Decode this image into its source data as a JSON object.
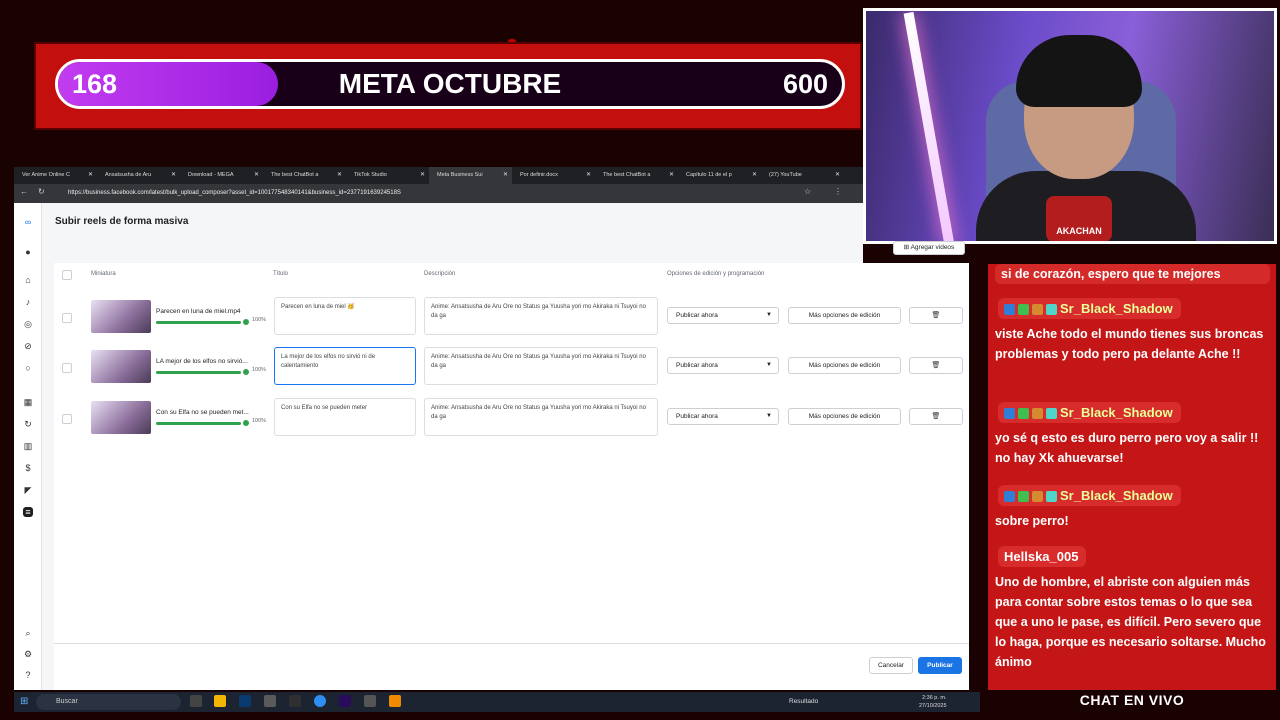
{
  "goal": {
    "current": "168",
    "title": "META OCTUBRE",
    "max": "600",
    "progress_fraction": 0.28
  },
  "webcam": {
    "logo_text": "AKACHAN"
  },
  "browser": {
    "tabs": [
      {
        "label": "Ver Anime Online C"
      },
      {
        "label": "Ansatsusha de Aru"
      },
      {
        "label": "Download - MEGA"
      },
      {
        "label": "The best ChatBot a"
      },
      {
        "label": "TikTok Studio"
      },
      {
        "label": "Meta Business Sui"
      },
      {
        "label": "Por definir.docx"
      },
      {
        "label": "The best ChatBot a"
      },
      {
        "label": "Capítulo 11 de el p"
      },
      {
        "label": "(27) YouTube"
      }
    ],
    "url": "https://business.facebook.com/latest/bulk_upload_composer?asset_id=100177548340141&business_id=237719163924518S"
  },
  "app": {
    "title": "Subir reels de forma masiva",
    "add_videos": "Agregar videos",
    "columns": {
      "thumb": "Miniatura",
      "title": "Título",
      "desc": "Descripción",
      "options": "Opciones de edición y programación"
    },
    "rows": [
      {
        "filename": "Parecen en luna de miel.mp4",
        "percent": "100%",
        "title": "Parecen en luna de miel 🥳",
        "description": "Anime: Ansatsusha de Aru Ore no Status ga Yuusha yori mo Akiraka ni Tsuyoi no da ga",
        "schedule": "Publicar ahora",
        "more": "Más opciones de edición"
      },
      {
        "filename": "LA mejor de los elfos no sirvió...",
        "percent": "100%",
        "title": "La mejor de los elfos no sirvió ni de calentamiento",
        "description": "Anime: Ansatsusha de Aru Ore no Status ga Yuusha yori mo Akiraka ni Tsuyoi no da ga",
        "schedule": "Publicar ahora",
        "more": "Más opciones de edición"
      },
      {
        "filename": "Con su Elfa no se pueden met...",
        "percent": "100%",
        "title": "Con su Elfa no se pueden meter",
        "description": "Anime: Ansatsusha de Aru Ore no Status ga Yuusha yori mo Akiraka ni Tsuyoi no da ga",
        "schedule": "Publicar ahora",
        "more": "Más opciones de edición"
      }
    ],
    "cancel": "Cancelar",
    "publish": "Publicar"
  },
  "taskbar": {
    "search": "Buscar",
    "tray": "Resultado",
    "time": "2:36 p. m.",
    "date": "27/10/2025"
  },
  "chat": {
    "messages": [
      {
        "user": "",
        "text": "si de corazón, espero que te mejores"
      },
      {
        "user": "Sr_Black_Shadow",
        "text": "viste Ache todo el mundo tienes sus broncas problemas y todo pero pa delante Ache !!"
      },
      {
        "user": "Sr_Black_Shadow",
        "text": "yo sé q esto es duro perro pero voy a salir !! no hay Xk ahuevarse!"
      },
      {
        "user": "Sr_Black_Shadow",
        "text": "sobre perro!"
      },
      {
        "user": "Hellska_005",
        "text": "Uno de hombre, el abriste con alguien más para contar sobre estos temas o lo que sea que a uno le pase, es difícil. Pero severo que lo haga, porque es necesario soltarse. Mucho ánimo"
      }
    ],
    "label": "CHAT EN VIVO"
  }
}
